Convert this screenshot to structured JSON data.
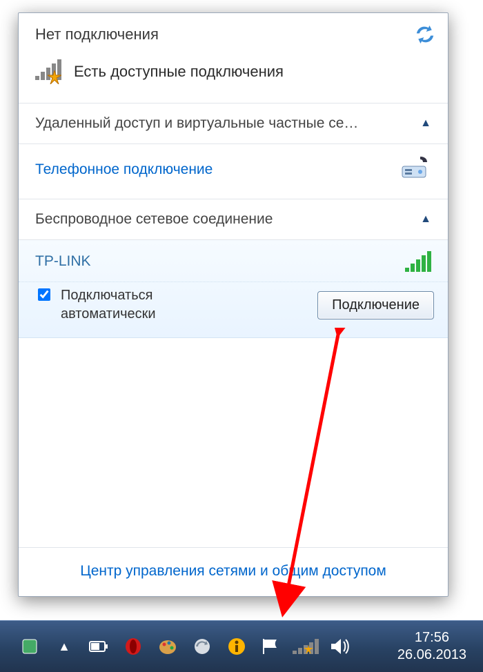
{
  "header": {
    "title": "Нет подключения",
    "status": "Есть доступные подключения"
  },
  "sections": {
    "dialup_group": "Удаленный доступ и виртуальные частные се…",
    "dialup_item": "Телефонное подключение",
    "wireless_group": "Беспроводное сетевое соединение"
  },
  "wifi": {
    "ssid": "TP-LINK",
    "auto_label": "Подключаться автоматически",
    "auto_checked": true,
    "connect_label": "Подключение"
  },
  "footer": {
    "link": "Центр управления сетями и общим доступом"
  },
  "taskbar": {
    "time": "17:56",
    "date": "26.06.2013"
  }
}
